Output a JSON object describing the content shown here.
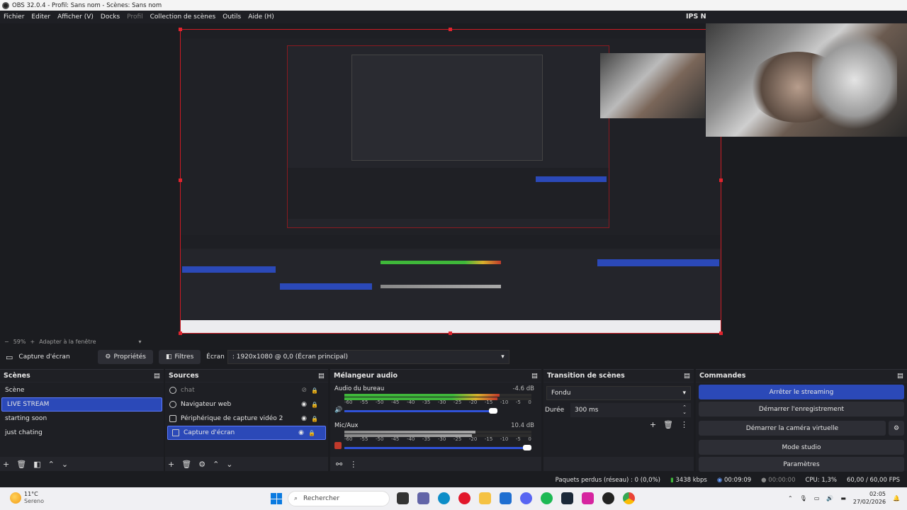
{
  "window": {
    "title": "OBS 32.0.4 - Profil: Sans nom - Scènes: Sans nom"
  },
  "menu": {
    "items": [
      "Fichier",
      "Editer",
      "Afficher (V)",
      "Docks",
      "Profil",
      "Collection de scènes",
      "Outils",
      "Aide (H)"
    ],
    "ips_label": "IPS N"
  },
  "zoom": {
    "percent": "59%",
    "fit_label": "Adapter à la fenêtre"
  },
  "source_toolbar": {
    "source_name": "Capture d'écran",
    "properties_label": "Propriétés",
    "filters_label": "Filtres",
    "screen_label": "Écran",
    "screen_value": ": 1920x1080 @ 0,0 (Écran principal)"
  },
  "scenes": {
    "title": "Scènes",
    "items": [
      "Scène",
      "LIVE STREAM",
      "starting soon",
      "just chating"
    ],
    "selected": "LIVE STREAM"
  },
  "sources": {
    "title": "Sources",
    "items": [
      "chat",
      "Navigateur web",
      "Périphérique de capture vidéo 2",
      "Capture d'écran"
    ]
  },
  "mixer": {
    "title": "Mélangeur audio",
    "channels": [
      {
        "name": "Audio du bureau",
        "db": "-4.6 dB",
        "level": 0.83
      },
      {
        "name": "Mic/Aux",
        "db": "10.4 dB",
        "level": 0.7
      }
    ],
    "scale": [
      "-60",
      "-55",
      "-50",
      "-45",
      "-40",
      "-35",
      "-30",
      "-25",
      "-20",
      "-15",
      "-10",
      "-5",
      "0"
    ]
  },
  "transitions": {
    "title": "Transition de scènes",
    "type": "Fondu",
    "duration_label": "Durée",
    "duration_value": "300 ms"
  },
  "commands": {
    "title": "Commandes",
    "buttons": [
      "Arrêter le streaming",
      "Démarrer l'enregistrement",
      "Démarrer la caméra virtuelle",
      "Mode studio",
      "Paramètres"
    ]
  },
  "status": {
    "dropped": "Paquets perdus (réseau) : 0 (0,0%)",
    "bitrate": "3438 kbps",
    "stream_time": "00:09:09",
    "rec_time": "00:00:00",
    "cpu": "CPU: 1,3%",
    "fps": "60,00 / 60,00 FPS"
  },
  "taskbar": {
    "temp": "11°C",
    "weather": "Sereno",
    "search_placeholder": "Rechercher",
    "time": "02:05",
    "date": "27/02/2026"
  },
  "colors": {
    "accent": "#2b49b8",
    "alert": "#d01b24",
    "meter_green": "#3fb83a",
    "meter_yellow": "#d8b02c"
  }
}
